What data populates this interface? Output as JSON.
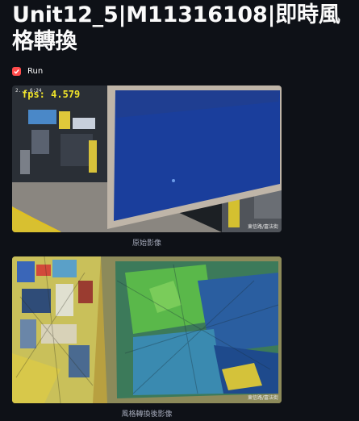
{
  "app": {
    "title": "Unit12_5|M11316108|即時風格轉換"
  },
  "controls": {
    "run_label": "Run",
    "run_checked": true
  },
  "original_frame": {
    "fps_text": "fps: 4.579",
    "timestamp_text": "2... 6:24",
    "location_text": "東信路/富法街",
    "caption": "原始影像"
  },
  "styled_frame": {
    "location_text": "東信路/富法街",
    "caption": "風格轉換後影像"
  }
}
